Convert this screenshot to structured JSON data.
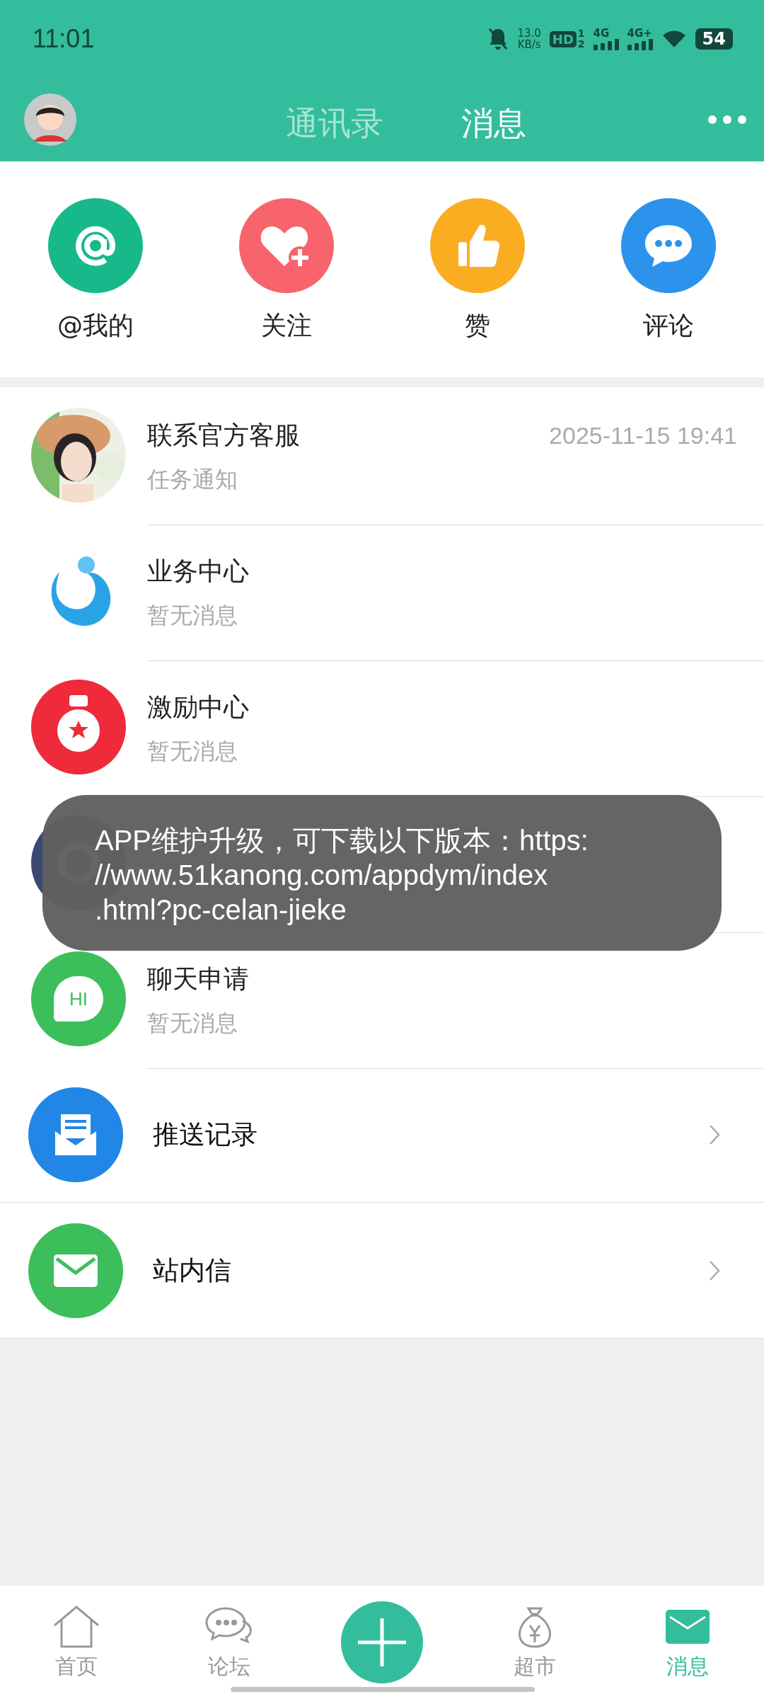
{
  "status_bar": {
    "time": "11:01",
    "net_speed": "13.0",
    "net_unit": "KB/s",
    "sim": "HD",
    "sim_slots": [
      "1",
      "2"
    ],
    "net1": "4G",
    "net2": "4G+",
    "battery": "54"
  },
  "header": {
    "tabs": [
      {
        "label": "通讯录",
        "selected": false
      },
      {
        "label": "消息",
        "selected": true
      }
    ]
  },
  "shortcuts": [
    {
      "kind": "at",
      "label": "@我的",
      "color": "#17b98b"
    },
    {
      "kind": "heart",
      "label": "关注",
      "color": "#f7646b"
    },
    {
      "kind": "thumb",
      "label": "赞",
      "color": "#fbad22"
    },
    {
      "kind": "comment",
      "label": "评论",
      "color": "#2b93ec"
    }
  ],
  "messages": [
    {
      "title": "联系官方客服",
      "time": "2025-11-15 19:41",
      "subtitle": "任务通知"
    },
    {
      "kind": "swirl",
      "title": "业务中心",
      "subtitle": "暂无消息"
    },
    {
      "kind": "medal",
      "title": "激励中心",
      "subtitle": "暂无消息"
    },
    {
      "kind": "gear"
    },
    {
      "kind": "hi",
      "icon_text": "HI",
      "title": "聊天申请",
      "subtitle": "暂无消息"
    }
  ],
  "links": [
    {
      "kind": "push",
      "label": "推送记录"
    },
    {
      "kind": "mail",
      "label": "站内信"
    }
  ],
  "toast": {
    "lines": [
      "APP维护升级，可下载以下版本：https:",
      "//www.51kanong.com/appdym/index",
      ".html?pc-celan-jieke"
    ]
  },
  "bottom_nav": [
    {
      "kind": "home",
      "label": "首页",
      "selected": false
    },
    {
      "kind": "forum",
      "label": "论坛",
      "selected": false
    },
    {
      "kind": "add"
    },
    {
      "kind": "market",
      "label": "超市",
      "selected": false
    },
    {
      "kind": "mail",
      "label": "消息",
      "selected": true
    }
  ]
}
